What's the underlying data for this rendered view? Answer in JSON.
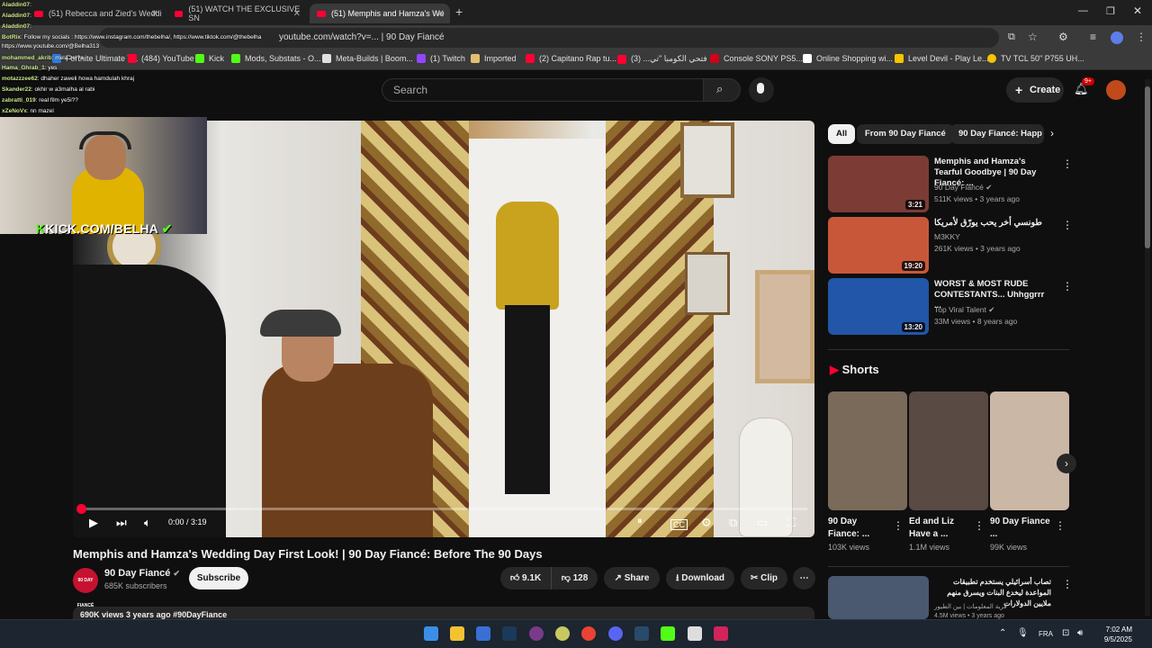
{
  "tabs": [
    {
      "label": "(51) Rebecca and Zied's Weddi"
    },
    {
      "label": "(51) WATCH THE EXCLUSIVE SN"
    },
    {
      "label": "(51) Memphis and Hamza's We",
      "active": true
    }
  ],
  "address": {
    "url": "youtube.com/watch?v=... | 90 Day Fiancé"
  },
  "bookmarks": [
    {
      "label": "Fortnite Ultimate T...",
      "color": "#2f7de1"
    },
    {
      "label": "(484) YouTube",
      "color": "#ff0033"
    },
    {
      "label": "Kick",
      "color": "#53fc18"
    },
    {
      "label": "Mods, Substats - O...",
      "color": "#53fc18"
    },
    {
      "label": "Meta-Builds | Boom...",
      "color": "#e0e0e0"
    },
    {
      "label": "(1) Twitch",
      "color": "#9146ff"
    },
    {
      "label": "Imported",
      "color": "#e0c070"
    },
    {
      "label": "(2) Capitano Rap tu...",
      "color": "#ff0033"
    },
    {
      "label": "فتحي الكومبا \"تي... (3)",
      "color": "#ff0033"
    },
    {
      "label": "Console SONY PS5...",
      "color": "#d0021b"
    },
    {
      "label": "Online Shopping wi...",
      "color": "#ffffff"
    },
    {
      "label": "Level Devil - Play Le...",
      "color": "#f7c400"
    },
    {
      "label": "TV TCL 50\" P755 UH...",
      "color": "#f7c400"
    }
  ],
  "chat": [
    {
      "user": "Aladdin07",
      "msg": ":"
    },
    {
      "user": "Aladdin07",
      "msg": ":"
    },
    {
      "user": "Aladdin07",
      "msg": ":"
    },
    {
      "user": "BotRix",
      "msg": ": Follow my socials : https://www.instagram.com/thebelha/, https://www.tiktok.com/@thebelha"
    },
    {
      "user": "",
      "msg": "https://www.youtube.com/@Belha313"
    },
    {
      "user": "mohammed_akrib",
      "msg": ": mela zel?a"
    },
    {
      "user": "Hama_Ghrab_1",
      "msg": ": yes"
    },
    {
      "user": "motazzzee62",
      "msg": ": dhaher zaweli howa hamdulah khraj"
    },
    {
      "user": "Skander22",
      "msg": ": okhir w a3malha al rabi"
    },
    {
      "user": "zabratti_019",
      "msg": ": real film ye5i??"
    },
    {
      "user": "xZeNoVx",
      "msg": ": nn mazel"
    }
  ],
  "kick_overlay": "KICK.COM/BELHA",
  "youtube": {
    "search_placeholder": "Search",
    "create_label": "Create",
    "notif_count": "9+",
    "player": {
      "time": "0:00 / 3:19",
      "progress": 0.0
    },
    "title": "Memphis and Hamza's Wedding Day First Look! | 90 Day Fiancé: Before The 90 Days",
    "channel": "90 Day Fiancé",
    "channel_logo": "90 DAY FIANCÉ",
    "subscribers": "685K subscribers",
    "subscribe_label": "Subscribe",
    "likes": "9.1K",
    "dislikes": "128",
    "share_label": "Share",
    "download_label": "Download",
    "clip_label": "Clip",
    "description_line": "690K views  3 years ago  #90DayFiance",
    "chips": [
      "All",
      "From 90 Day Fiancé",
      "90 Day Fiancé: Happ"
    ],
    "recommendations": [
      {
        "title": "Memphis and Hamza's Tearful Goodbye | 90 Day Fiancé: ...",
        "channel": "90 Day Fiancé",
        "views": "511K views • 3 years ago",
        "duration": "3:21",
        "color": "#7c3b35"
      },
      {
        "title": "طونسي أخر يحب يورّق لأمريكا",
        "channel": "M3KKY",
        "views": "261K views • 3 years ago",
        "duration": "19:20",
        "color": "#c8573a"
      },
      {
        "title": "WORST & MOST RUDE CONTESTANTS... Uhhggrrr ...",
        "channel": "Top Viral Talent",
        "views": "33M views • 8 years ago",
        "duration": "13:20",
        "color": "#2156a8"
      }
    ],
    "shorts_header": "Shorts",
    "shorts": [
      {
        "title": "90 Day Fiance: ...",
        "views": "103K views",
        "color": "#7a6a5a"
      },
      {
        "title": "Ed and Liz Have a ...",
        "views": "1.1M views",
        "color": "#5a4a44"
      },
      {
        "title": "90 Day Fiance ...",
        "views": "99K views",
        "color": "#cbb7a5"
      }
    ],
    "bottom_rec": {
      "title": "تصاب أسرائيلي يستخدم تطبيقات المواعدة ليخدع البنات ويسرق منهم ملايين الدولارات",
      "channel": "قرية المعلومات | بين الطيور",
      "views": "4.5M views • 3 years ago",
      "color": "#4a5870"
    }
  },
  "taskbar": {
    "time": "7:02 AM",
    "date": "9/5/2025",
    "lang": "FRA"
  }
}
